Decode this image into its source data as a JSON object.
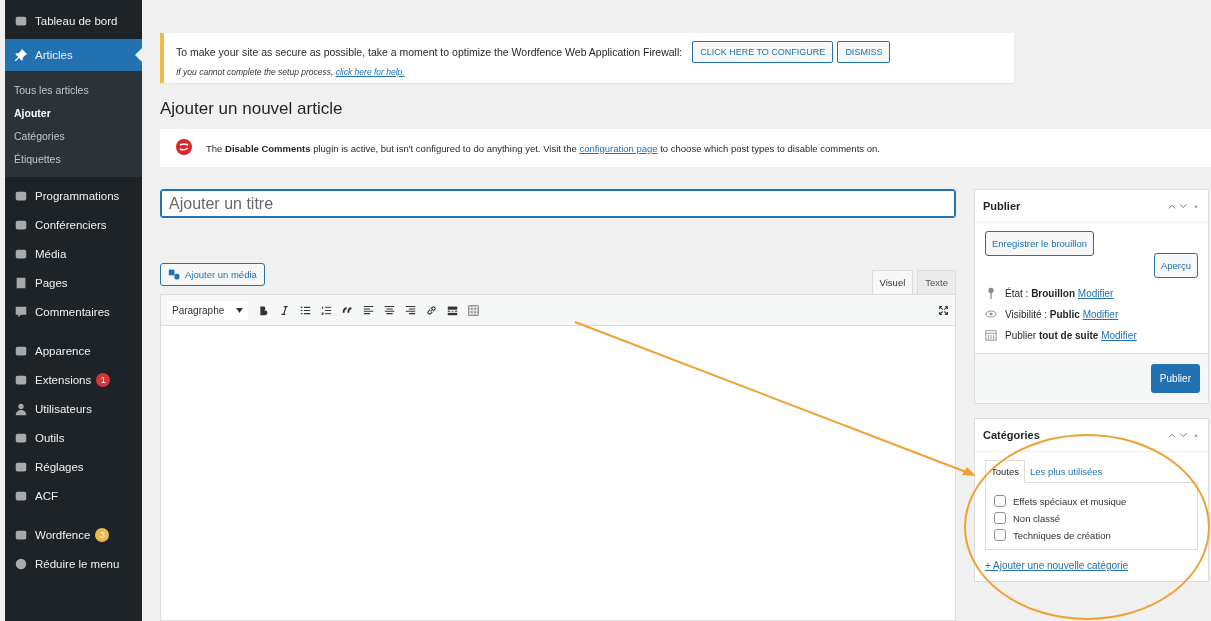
{
  "sidebar": {
    "groups": [
      [
        {
          "label": "Tableau de bord",
          "selected": false
        },
        {
          "label": "Articles",
          "selected": true,
          "children": [
            {
              "label": "Tous les articles",
              "selected": false
            },
            {
              "label": "Ajouter",
              "selected": true
            },
            {
              "label": "Catégories",
              "selected": false
            },
            {
              "label": "Étiquettes",
              "selected": false
            }
          ]
        },
        {
          "label": "Programmations",
          "selected": false
        },
        {
          "label": "Conférenciers",
          "selected": false
        },
        {
          "label": "Média",
          "selected": false
        },
        {
          "label": "Pages",
          "selected": false
        },
        {
          "label": "Commentaires",
          "selected": false
        }
      ],
      [
        {
          "label": "Apparence",
          "selected": false
        },
        {
          "label": "Extensions",
          "selected": false,
          "badge": {
            "text": "1",
            "color": "#d63638"
          }
        },
        {
          "label": "Utilisateurs",
          "selected": false
        },
        {
          "label": "Outils",
          "selected": false
        },
        {
          "label": "Réglages",
          "selected": false
        },
        {
          "label": "ACF",
          "selected": false
        }
      ],
      [
        {
          "label": "Wordfence",
          "selected": false,
          "badge": {
            "text": "3",
            "color": "#f0b849"
          }
        },
        {
          "label": "Réduire le menu",
          "selected": false
        }
      ]
    ]
  },
  "firewall_notice": {
    "message": "To make your site as secure as possible, take a moment to optimize the Wordfence Web Application Firewall:",
    "buttons": [
      "CLICK HERE TO CONFIGURE",
      "DISMISS"
    ],
    "help_text": "If you cannot complete the setup process, ",
    "help_link": "click here for help."
  },
  "page_title": "Ajouter un nouvel article",
  "comments_notice": {
    "text": "The **Disable Comments** plugin is active, but isn't configured to do anything yet. Visit the ",
    "link": "configuration page",
    "text_after": " to choose which post types to disable comments on."
  },
  "title_field": {
    "placeholder": "Ajouter un titre"
  },
  "editor": {
    "media_button": "Ajouter un média",
    "tabs": [
      {
        "label": "Visuel",
        "selected": true
      },
      {
        "label": "Texte",
        "selected": false
      }
    ],
    "format_select": "Paragraphe"
  },
  "publish_box": {
    "title": "Publier",
    "save_draft": "Enregistrer le brouillon",
    "preview": "Aperçu",
    "rows": [
      {
        "label": "État : ",
        "value": "Brouillon",
        "link": "Modifier"
      },
      {
        "label": "Visibilité : ",
        "value": "Public",
        "link": "Modifier"
      },
      {
        "label": "Publier ",
        "value": "tout de suite",
        "link": "Modifier"
      }
    ],
    "publish_button": "Publier"
  },
  "categories_box": {
    "title": "Catégories",
    "tabs": [
      {
        "label": "Toutes",
        "selected": true
      },
      {
        "label": "Les plus utilisées",
        "selected": false
      }
    ],
    "items": [
      {
        "label": "Effets spéciaux et musique",
        "checked": false
      },
      {
        "label": "Non classé",
        "checked": false
      },
      {
        "label": "Techniques de création",
        "checked": false
      }
    ],
    "add_link": "+ Ajouter une nouvelle catégorie"
  }
}
